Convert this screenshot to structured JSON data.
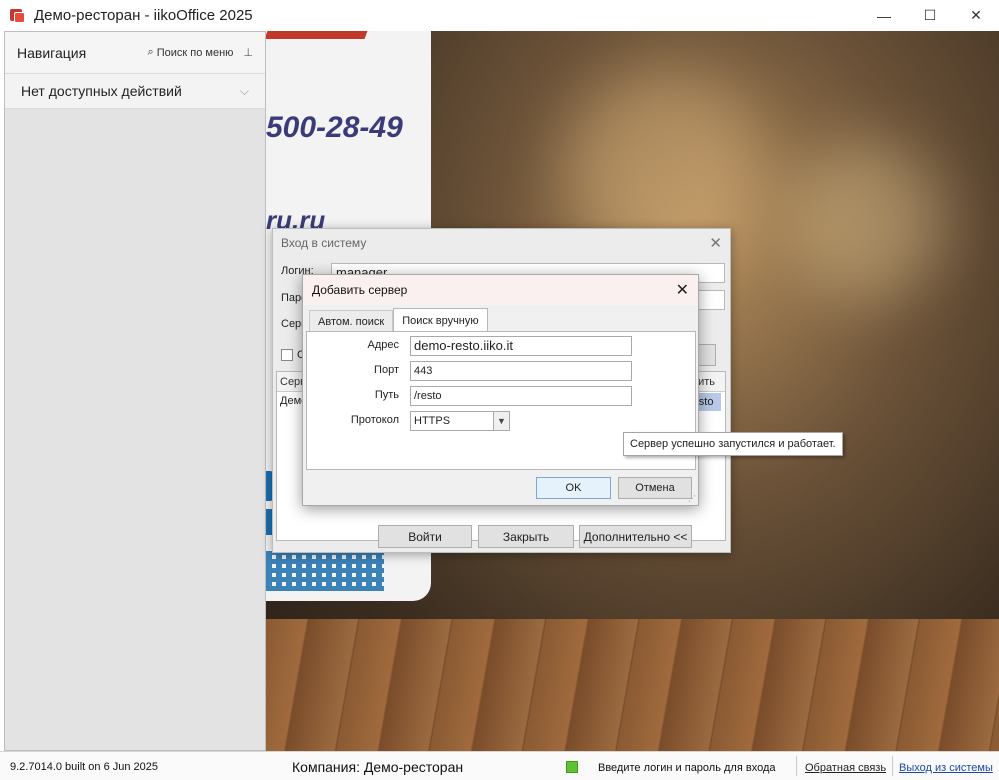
{
  "window": {
    "title": "Демо-ресторан - iikoOffice 2025",
    "minimize": "—",
    "maximize": "☐",
    "close": "✕"
  },
  "nav": {
    "title": "Навигация",
    "search_label": "Поиск по меню",
    "search_icon": "⌕",
    "pin_icon": "📌",
    "item_label": "Нет доступных действий",
    "chevron": "⌵"
  },
  "promo": {
    "phone": "500-28-49",
    "url": "ru.ru"
  },
  "login": {
    "title": "Вход в систему",
    "close": "✕",
    "login_label": "Логин:",
    "login_value": "manager",
    "password_label": "Паро",
    "server_label": "Серв",
    "checkbox_label": "С",
    "grid_header": "Серв",
    "grid_header_right": "ить",
    "grid_row": "Демо",
    "grid_selected": "resto",
    "enter_button": "Войти",
    "close_button": "Закрыть",
    "more_button": "Дополнительно <<"
  },
  "add_server": {
    "title": "Добавить сервер",
    "close": "✕",
    "tab_auto": "Автом. поиск",
    "tab_manual": "Поиск вручную",
    "address_label": "Адрес",
    "address_value": "demo-resto.iiko.it",
    "port_label": "Порт",
    "port_value": "443",
    "path_label": "Путь",
    "path_value": "/resto",
    "protocol_label": "Протокол",
    "protocol_value": "HTTPS",
    "ok_button": "OK",
    "cancel_button": "Отмена"
  },
  "tooltip": {
    "text": "Сервер успешно запустился и работает."
  },
  "statusbar": {
    "version": "9.2.7014.0 built on 6 Jun 2025",
    "company": "Компания: Демо-ресторан",
    "hint": "Введите логин и пароль для входа",
    "feedback": "Обратная связь",
    "logout": "Выход из системы"
  }
}
